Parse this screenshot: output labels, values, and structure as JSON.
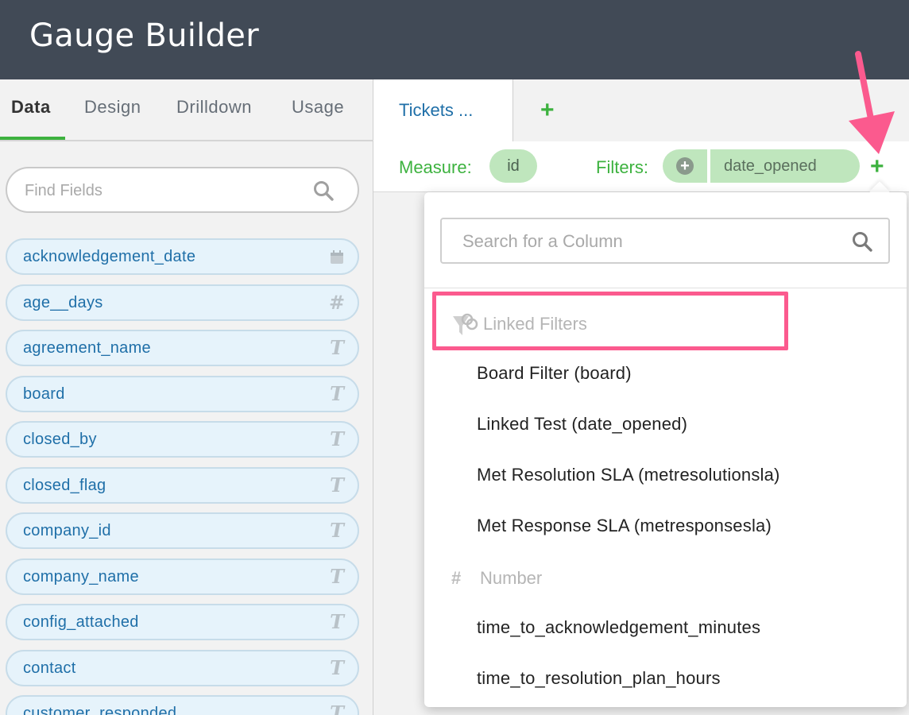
{
  "header": {
    "title": "Gauge Builder"
  },
  "sidebar": {
    "tabs": [
      {
        "label": "Data",
        "active": true
      },
      {
        "label": "Design",
        "active": false
      },
      {
        "label": "Drilldown",
        "active": false
      },
      {
        "label": "Usage",
        "active": false
      }
    ],
    "search": {
      "placeholder": "Find Fields"
    },
    "fields": [
      {
        "name": "acknowledgement_date",
        "type": "date",
        "icon": "calendar-icon"
      },
      {
        "name": "age__days",
        "type": "number",
        "icon": "hash-icon"
      },
      {
        "name": "agreement_name",
        "type": "text",
        "icon": "text-type-icon"
      },
      {
        "name": "board",
        "type": "text",
        "icon": "text-type-icon"
      },
      {
        "name": "closed_by",
        "type": "text",
        "icon": "text-type-icon"
      },
      {
        "name": "closed_flag",
        "type": "text",
        "icon": "text-type-icon"
      },
      {
        "name": "company_id",
        "type": "text",
        "icon": "text-type-icon"
      },
      {
        "name": "company_name",
        "type": "text",
        "icon": "text-type-icon"
      },
      {
        "name": "config_attached",
        "type": "text",
        "icon": "text-type-icon"
      },
      {
        "name": "contact",
        "type": "text",
        "icon": "text-type-icon"
      },
      {
        "name": "customer_responded",
        "type": "text",
        "icon": "text-type-icon"
      }
    ]
  },
  "main": {
    "tabs": [
      {
        "label": "Tickets ..."
      }
    ],
    "add_tab_label": "+",
    "measure": {
      "label": "Measure:",
      "value": "id"
    },
    "filters": {
      "label": "Filters:",
      "items": [
        "date_opened"
      ],
      "add_label": "+"
    }
  },
  "dropdown": {
    "search": {
      "placeholder": "Search for a Column"
    },
    "groups": [
      {
        "header": "Linked Filters",
        "icon": "linked-filter-icon",
        "items": [
          "Board Filter (board)",
          "Linked Test (date_opened)",
          "Met Resolution SLA (metresolutionsla)",
          "Met Response SLA (metresponsesla)"
        ]
      },
      {
        "header": "Number",
        "icon": "hash-icon",
        "items": [
          "time_to_acknowledgement_minutes",
          "time_to_resolution_plan_hours"
        ]
      }
    ]
  },
  "colors": {
    "header_bg": "#414a56",
    "accent_green": "#3db23f",
    "link_blue": "#1f6fa8",
    "pill_green": "#bfe6bd",
    "field_pill_bg": "#e6f3fb",
    "annotation_pink": "#fb5a8e"
  }
}
